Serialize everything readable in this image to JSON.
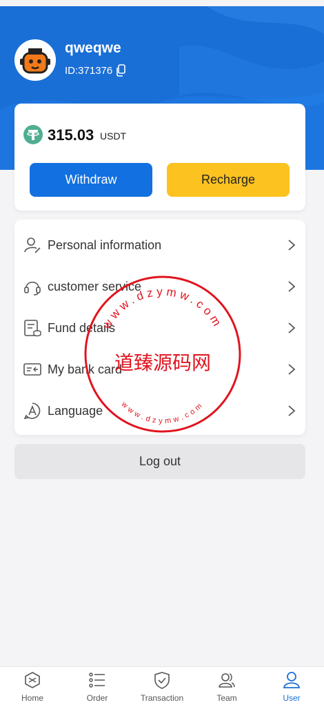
{
  "profile": {
    "username": "qweqwe",
    "id_text": "ID:371376"
  },
  "balance": {
    "amount": "315.03",
    "unit": "USDT",
    "withdraw_label": "Withdraw",
    "recharge_label": "Recharge"
  },
  "menu": {
    "items": [
      {
        "label": "Personal information",
        "icon": "person-icon"
      },
      {
        "label": "customer service",
        "icon": "headset-icon"
      },
      {
        "label": "Fund details",
        "icon": "fund-details-icon"
      },
      {
        "label": "My bank card",
        "icon": "bank-card-icon"
      },
      {
        "label": "Language",
        "icon": "language-icon"
      }
    ]
  },
  "logout_label": "Log out",
  "watermark": {
    "text": "道臻源码网",
    "url_text": "www.dzymw.com"
  },
  "tabbar": {
    "items": [
      {
        "label": "Home",
        "icon": "home-icon"
      },
      {
        "label": "Order",
        "icon": "order-icon"
      },
      {
        "label": "Transaction",
        "icon": "shield-check-icon"
      },
      {
        "label": "Team",
        "icon": "team-icon"
      },
      {
        "label": "User",
        "icon": "user-icon"
      }
    ],
    "active": "User"
  },
  "colors": {
    "primary": "#1a6fd6",
    "withdraw": "#1270e0",
    "recharge": "#fcc21f",
    "stamp": "#e0141e"
  }
}
